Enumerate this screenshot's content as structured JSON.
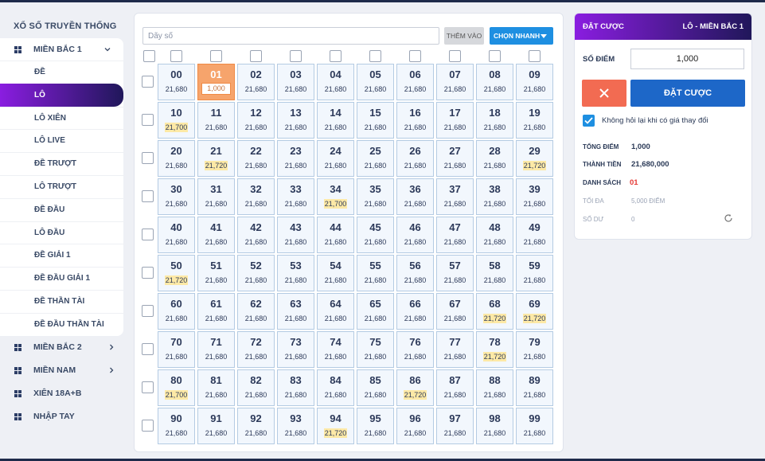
{
  "sidebar": {
    "header": "XỔ SỐ TRUYỀN THỐNG",
    "expanded_group": {
      "label": "MIỀN BẮC 1",
      "items": [
        {
          "label": "ĐỀ"
        },
        {
          "label": "LÔ",
          "active": true
        },
        {
          "label": "LÔ XIÊN"
        },
        {
          "label": "LÔ LIVE"
        },
        {
          "label": "ĐỀ TRƯỢT"
        },
        {
          "label": "LÔ TRƯỢT"
        },
        {
          "label": "ĐỀ ĐẦU"
        },
        {
          "label": "LÔ ĐẦU"
        },
        {
          "label": "ĐỀ GIẢI 1"
        },
        {
          "label": "ĐỀ ĐẦU GIẢI 1"
        },
        {
          "label": "ĐỀ THẦN TÀI"
        },
        {
          "label": "ĐỀ ĐẦU THẦN TÀI"
        }
      ]
    },
    "other_groups": [
      {
        "label": "MIỀN BẮC 2",
        "chevron": true
      },
      {
        "label": "MIỀN NAM",
        "chevron": true
      },
      {
        "label": "XIÊN 18A+B",
        "chevron": false
      },
      {
        "label": "NHẬP TAY",
        "chevron": false
      }
    ]
  },
  "board": {
    "input_placeholder": "Dãy số",
    "add_button": "THÊM VÀO",
    "quick_select_button": "CHỌN NHANH",
    "default_odds": "21,680",
    "highlight_odds": {
      "10": "21,700",
      "29": "21,720",
      "21": "21,720",
      "34": "21,700",
      "50": "21,720",
      "68": "21,720",
      "69": "21,720",
      "78": "21,720",
      "80": "21,700",
      "86": "21,720",
      "94": "21,720"
    },
    "selected": {
      "number": "01",
      "amount": "1,000"
    }
  },
  "panel": {
    "title": "ĐẶT CƯỢC",
    "mode": "LÔ - MIỀN BẮC 1",
    "so_diem_label": "SỐ ĐIỂM",
    "so_diem_value": "1,000",
    "submit_label": "ĐẶT CƯỢC",
    "checkbox_label": "Không hỏi lại khi có giá thay đổi",
    "checkbox_checked": true,
    "summary": {
      "tong_diem_label": "TỔNG ĐIỂM",
      "tong_diem": "1,000",
      "thanh_tien_label": "THÀNH TIỀN",
      "thanh_tien": "21,680,000",
      "danh_sach_label": "DANH SÁCH",
      "danh_sach": "01",
      "toi_da_label": "TỐI ĐA",
      "toi_da": "5,000 ĐIỂM",
      "so_du_label": "SỐ DƯ",
      "so_du": "0"
    }
  },
  "colors": {
    "accent_gradient_start": "#8a1de0",
    "accent_gradient_end": "#20175a",
    "primary_blue": "#1d67c8",
    "quick_blue": "#1e8fe1",
    "cancel_red": "#f26b52",
    "selected_cell": "#f6a46c",
    "highlight_odds": "#fde9a6"
  }
}
